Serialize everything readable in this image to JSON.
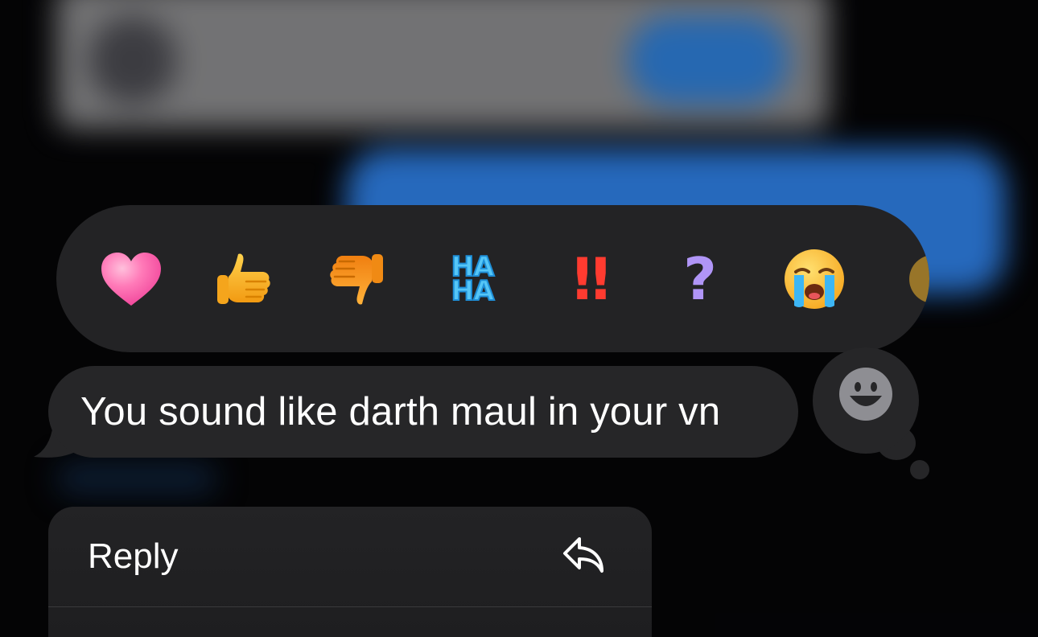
{
  "reactions": [
    {
      "name": "heart",
      "color": "#ff6fb0"
    },
    {
      "name": "thumbs-up",
      "color": "#f8b024"
    },
    {
      "name": "thumbs-down",
      "color": "#f39a1d"
    },
    {
      "name": "haha",
      "label_top": "HA",
      "label_bottom": "HA",
      "color": "#4cc0f5"
    },
    {
      "name": "exclamation",
      "label": "!!",
      "color": "#ff3b30"
    },
    {
      "name": "question",
      "label": "?",
      "color": "#a98bf5"
    },
    {
      "name": "crying-face",
      "color": "#ffc93c"
    }
  ],
  "message": {
    "text": "You sound like darth maul in your vn"
  },
  "menu": {
    "items": [
      {
        "label": "Reply",
        "icon": "reply-arrow-icon"
      }
    ]
  },
  "colors": {
    "bubble": "#262628",
    "reaction_bar": "#232325",
    "blurred_blue": "#2f80e6"
  }
}
